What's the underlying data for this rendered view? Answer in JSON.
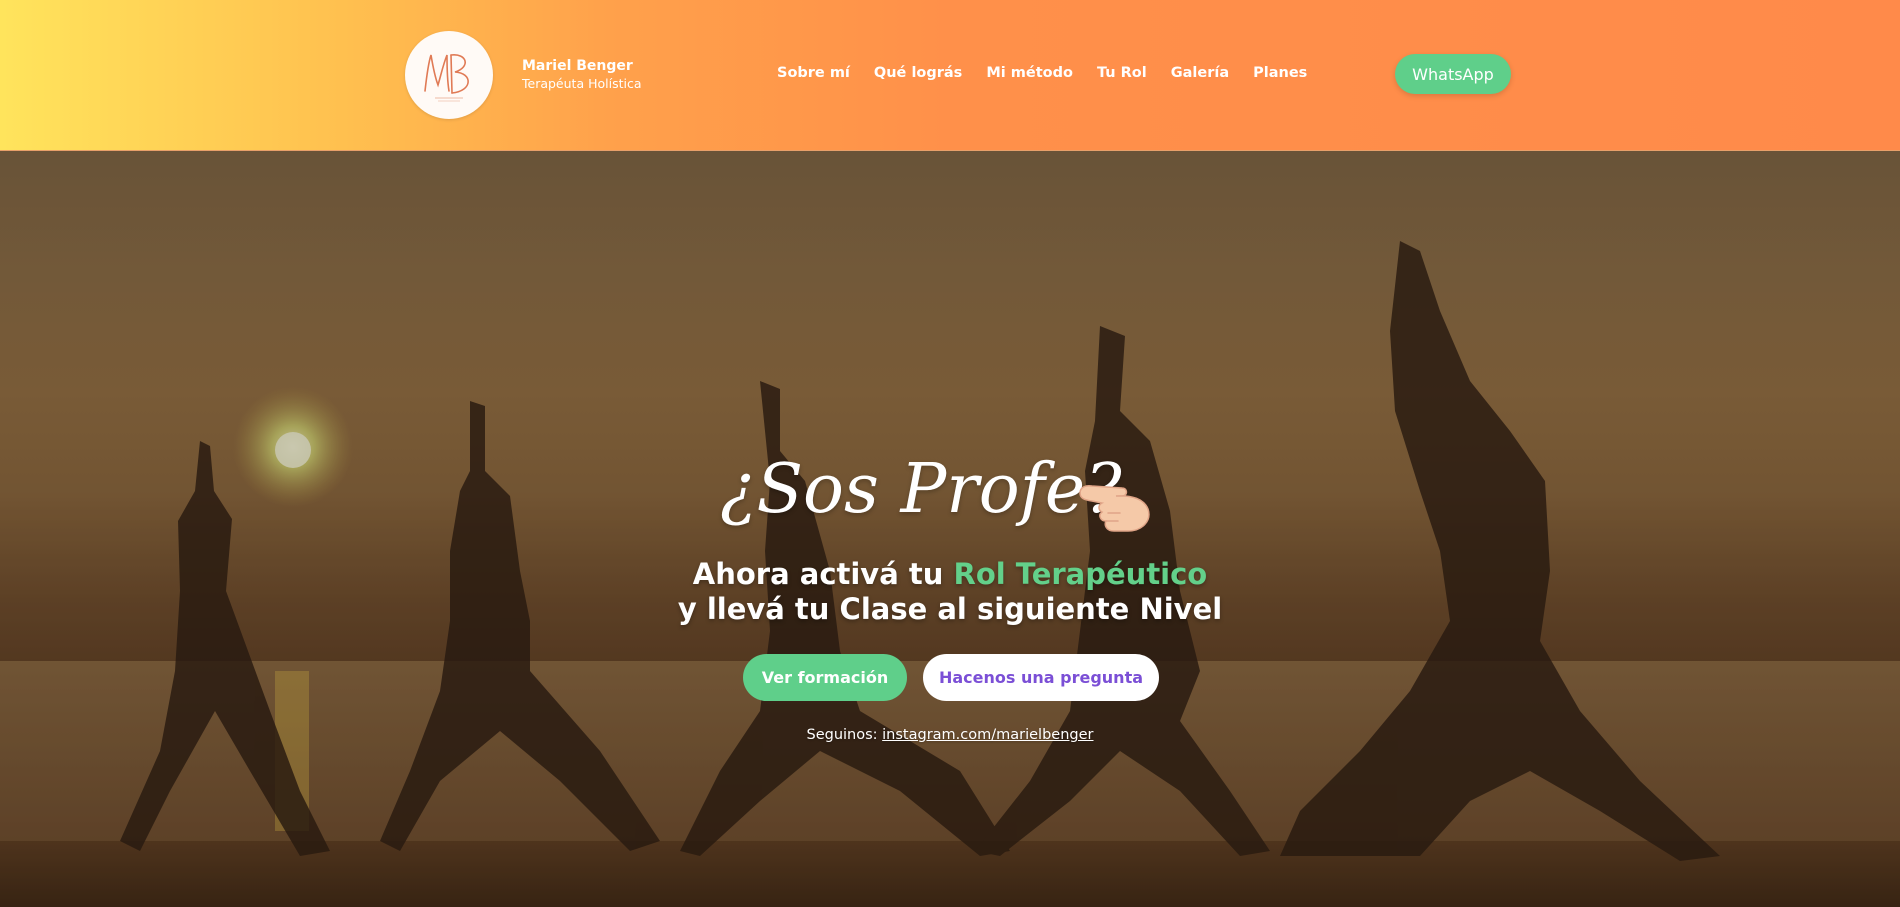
{
  "header": {
    "brand_name": "Mariel Benger",
    "brand_subtitle": "Terapéuta Holística",
    "nav": [
      "Sobre mí",
      "Qué lográs",
      "Mi método",
      "Tu Rol",
      "Galería",
      "Planes"
    ],
    "whatsapp_label": "WhatsApp"
  },
  "hero": {
    "title": "¿Sos Profe?",
    "line1_prefix": "Ahora activá tu ",
    "line1_accent": "Rol Terapéutico",
    "line2": "y llevá tu Clase al siguiente Nivel",
    "primary_button": "Ver formación",
    "secondary_button": "Hacenos una pregunta",
    "follow_prefix": "Seguinos: ",
    "follow_link": "instagram.com/marielbenger"
  },
  "colors": {
    "accent_green": "#5fcf8a",
    "secondary_text_purple": "#7b4fd6",
    "header_gradient_start": "#ffe45c",
    "header_gradient_end": "#ff8a4a"
  }
}
